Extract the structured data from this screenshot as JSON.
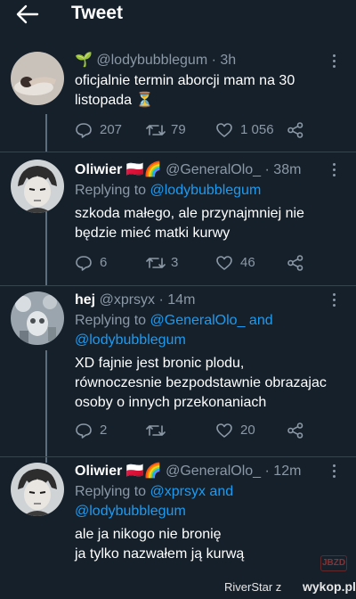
{
  "header": {
    "title": "Tweet"
  },
  "tweets": [
    {
      "display_name": "",
      "handle": "@lodybubblegum",
      "time": "· 3h",
      "reply_prefix": "",
      "reply_to_1": "",
      "reply_and": "",
      "reply_to_2": "",
      "text_lines": [
        "oficjalnie termin aborcji mam na 30",
        "listopada ⏳"
      ],
      "replies": "207",
      "retweets": "79",
      "likes": "1 056"
    },
    {
      "display_name": "Oliwier 🇵🇱🌈",
      "handle": "@GeneralOlo_",
      "time": "· 38m",
      "reply_prefix": "Replying to ",
      "reply_to_1": "@lodybubblegum",
      "reply_and": "",
      "reply_to_2": "",
      "text_lines": [
        "szkoda małego, ale przynajmniej nie",
        "będzie mieć matki kurwy"
      ],
      "replies": "6",
      "retweets": "3",
      "likes": "46"
    },
    {
      "display_name": "hej",
      "handle": "@xprsyx",
      "time": "· 14m",
      "reply_prefix": "Replying to ",
      "reply_to_1": "@GeneralOlo_",
      "reply_and": " and",
      "reply_to_2": "@lodybubblegum",
      "text_lines": [
        "XD fajnie jest bronic plodu,",
        "równoczesnie bezpodstawnie obrazajac",
        "osoby o innych przekonaniach"
      ],
      "replies": "2",
      "retweets": "",
      "likes": "20"
    },
    {
      "display_name": "Oliwier 🇵🇱🌈",
      "handle": "@GeneralOlo_",
      "time": "· 12m",
      "reply_prefix": "Replying to ",
      "reply_to_1": "@xprsyx",
      "reply_and": " and",
      "reply_to_2": "@lodybubblegum",
      "text_lines": [
        "ale ja nikogo nie bronię",
        "ja tylko nazwałem ją kurwą"
      ],
      "replies": "",
      "retweets": "",
      "likes": ""
    }
  ],
  "watermark": {
    "user": "RiverStar z",
    "site": "wykop.pl",
    "stamp": "JBZD"
  },
  "colors": {
    "background": "#15202b",
    "link": "#1d9bf0",
    "muted": "#8b98a5",
    "divider": "#38444d"
  }
}
